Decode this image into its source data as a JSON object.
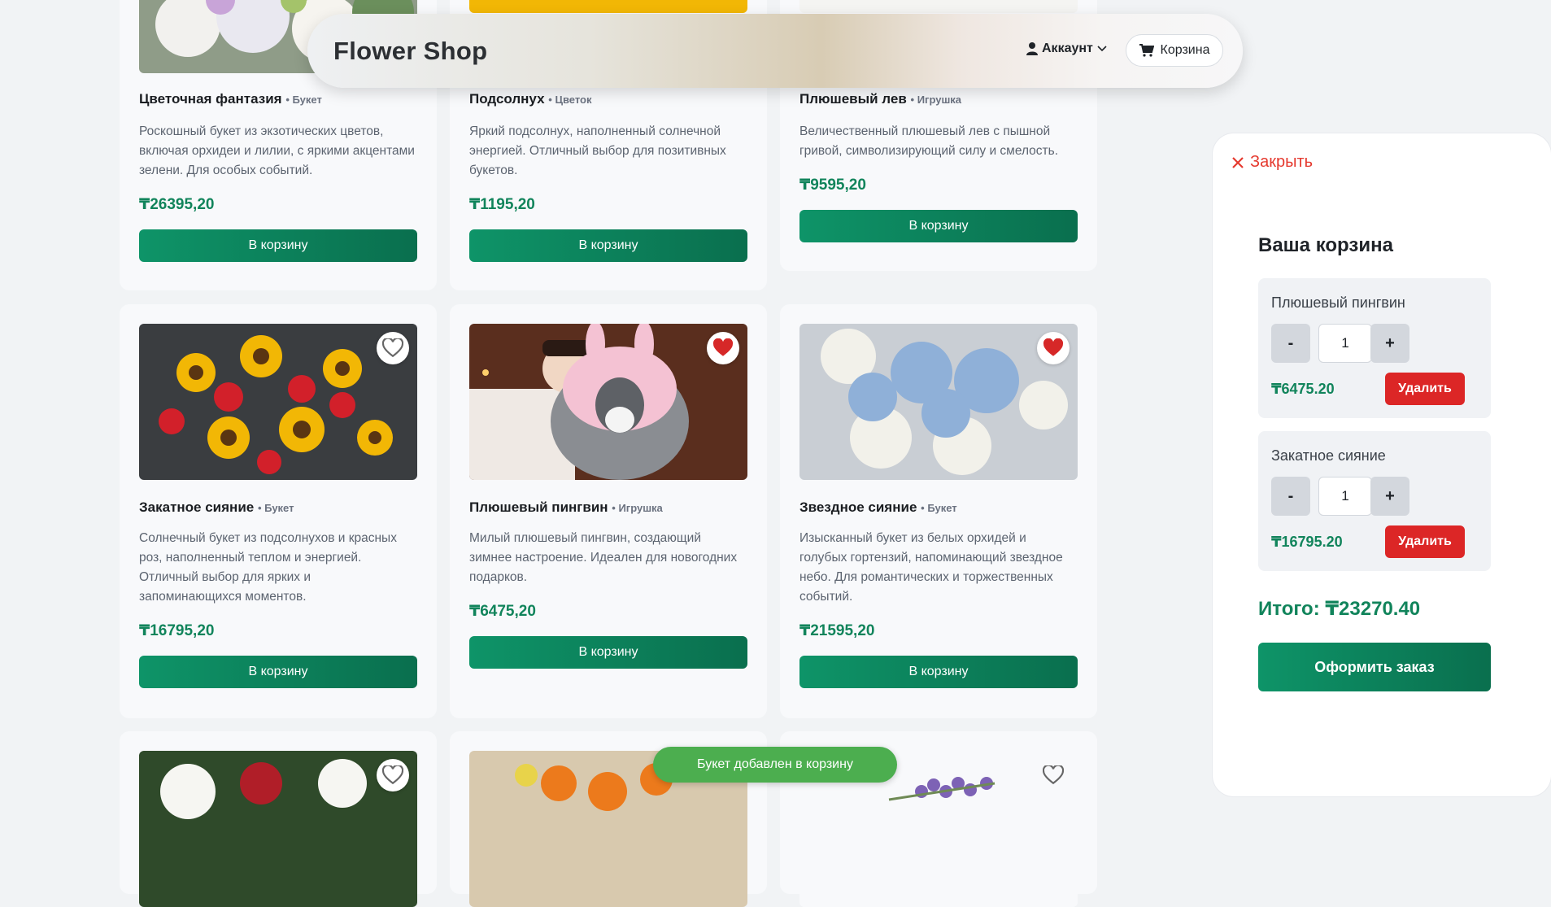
{
  "header": {
    "logo": "Flower Shop",
    "account_label": "Аккаунт",
    "cart_label": "Корзина"
  },
  "products": [
    {
      "name": "Цветочная фантазия",
      "category": "Букет",
      "description": "Роскошный букет из экзотических цветов, включая орхидеи и лилии, с яркими акцентами зелени. Для особых событий.",
      "price": "₸26395,20",
      "button": "В корзину"
    },
    {
      "name": "Подсолнух",
      "category": "Цветок",
      "description": "Яркий подсолнух, наполненный солнечной энергией. Отличный выбор для позитивных букетов.",
      "price": "₸1195,20",
      "button": "В корзину"
    },
    {
      "name": "Плюшевый лев",
      "category": "Игрушка",
      "description": "Величественный плюшевый лев с пышной гривой, символизирующий силу и смелость.",
      "price": "₸9595,20",
      "button": "В корзину"
    },
    {
      "name": "Закатное сияние",
      "category": "Букет",
      "description": "Солнечный букет из подсолнухов и красных роз, наполненный теплом и энергией. Отличный выбор для ярких и запоминающихся моментов.",
      "price": "₸16795,20",
      "button": "В корзину",
      "favorite": false
    },
    {
      "name": "Плюшевый пингвин",
      "category": "Игрушка",
      "description": "Милый плюшевый пингвин, создающий зимнее настроение. Идеален для новогодних подарков.",
      "price": "₸6475,20",
      "button": "В корзину",
      "favorite": true
    },
    {
      "name": "Звездное сияние",
      "category": "Букет",
      "description": "Изысканный букет из белых орхидей и голубых гортензий, напоминающий звездное небо. Для романтических и торжественных событий.",
      "price": "₸21595,20",
      "button": "В корзину",
      "favorite": true
    }
  ],
  "cart": {
    "close_label": "Закрыть",
    "heading": "Ваша корзина",
    "items": [
      {
        "name": "Плюшевый пингвин",
        "qty": "1",
        "price": "₸6475.20",
        "minus": "-",
        "plus": "+",
        "delete_label": "Удалить"
      },
      {
        "name": "Закатное сияние",
        "qty": "1",
        "price": "₸16795.20",
        "minus": "-",
        "plus": "+",
        "delete_label": "Удалить"
      }
    ],
    "total": "Итого: ₸23270.40",
    "checkout_label": "Оформить заказ"
  },
  "toast": "Букет добавлен в корзину",
  "colors": {
    "accent": "#0e9468",
    "price": "#11845b",
    "danger": "#dc2626",
    "toast": "#4cae4f"
  }
}
